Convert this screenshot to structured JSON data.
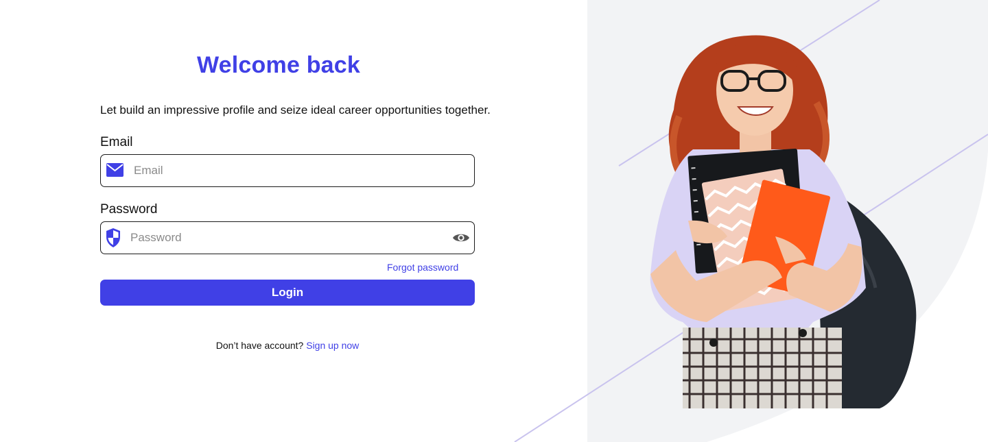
{
  "login": {
    "title": "Welcome back",
    "subtitle": "Let build an impressive profile and seize ideal career opportunities together.",
    "email": {
      "label": "Email",
      "placeholder": "Email",
      "value": ""
    },
    "password": {
      "label": "Password",
      "placeholder": "Password",
      "value": ""
    },
    "forgot_label": "Forgot password",
    "login_label": "Login",
    "signup_prompt": "Don’t have account?",
    "signup_link": "Sign up now"
  },
  "icons": {
    "email": "mail-icon",
    "password": "shield-icon",
    "toggle_visibility": "eye-icon"
  },
  "hero": {
    "image": "student-with-notebooks-illustration"
  },
  "colors": {
    "accent": "#4040e6",
    "panel_bg": "#f2f3f5",
    "decor_line": "#c9c3ee"
  }
}
